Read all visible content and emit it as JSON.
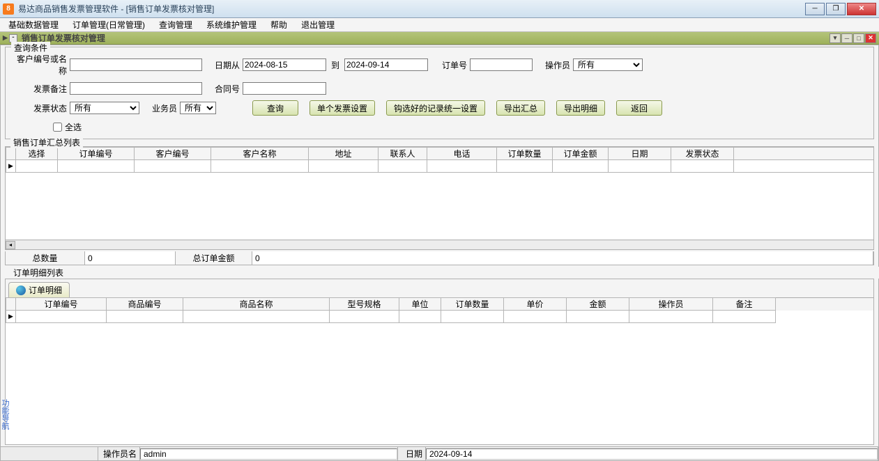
{
  "window": {
    "title": "易达商品销售发票管理软件  - [销售订单发票核对管理]"
  },
  "menubar": [
    "基础数据管理",
    "订单管理(日常管理)",
    "查询管理",
    "系统维护管理",
    "帮助",
    "退出管理"
  ],
  "subwindow": {
    "title": "销售订单发票核对管理"
  },
  "query": {
    "group_title": "查询条件",
    "labels": {
      "customer": "客户编号或名称",
      "date_from": "日期从",
      "date_to": "到",
      "order_no": "订单号",
      "operator": "操作员",
      "invoice_remark": "发票备注",
      "contract_no": "合同号",
      "invoice_status": "发票状态",
      "salesperson": "业务员",
      "select_all": "全选"
    },
    "values": {
      "customer": "",
      "date_from": "2024-08-15",
      "date_to": "2024-09-14",
      "order_no": "",
      "operator": "所有",
      "invoice_remark": "",
      "contract_no": "",
      "invoice_status": "所有",
      "salesperson": "所有"
    },
    "buttons": {
      "search": "查询",
      "single_invoice": "单个发票设置",
      "batch_setting": "钩选好的记录统一设置",
      "export_summary": "导出汇总",
      "export_detail": "导出明细",
      "return": "返回"
    }
  },
  "summary_grid": {
    "title": "销售订单汇总列表",
    "headers": [
      "选择",
      "订单编号",
      "客户编号",
      "客户名称",
      "地址",
      "联系人",
      "电话",
      "订单数量",
      "订单金额",
      "日期",
      "发票状态"
    ]
  },
  "summary": {
    "total_qty_label": "总数量",
    "total_qty": "0",
    "total_amount_label": "总订单金额",
    "total_amount": "0"
  },
  "detail_section": {
    "title": "订单明细列表",
    "tab": "订单明细",
    "headers": [
      "订单编号",
      "商品编号",
      "商品名称",
      "型号规格",
      "单位",
      "订单数量",
      "单价",
      "金额",
      "操作员",
      "备注"
    ]
  },
  "side_tab": "功能导航",
  "statusbar": {
    "operator_label": "操作员名",
    "operator": "admin",
    "date_label": "日期",
    "date": "2024-09-14"
  }
}
